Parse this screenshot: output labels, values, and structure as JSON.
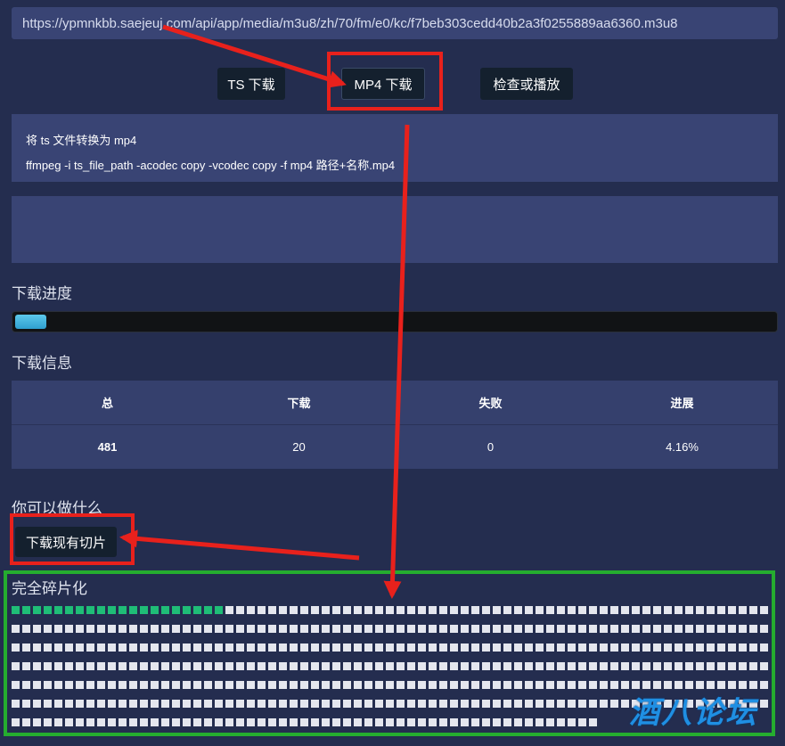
{
  "url": "https://ypmnkbb.saejeuj.com/api/app/media/m3u8/zh/70/fm/e0/kc/f7beb303cedd40b2a3f0255889aa6360.m3u8",
  "buttons": {
    "ts_download": "TS 下载",
    "mp4_download": "MP4 下载",
    "check_play": "检查或播放",
    "download_existing": "下载现有切片"
  },
  "info": {
    "line1": "将 ts 文件转换为 mp4",
    "line2": "ffmpeg -i ts_file_path -acodec copy -vcodec copy -f mp4 路径+名称.mp4"
  },
  "progress": {
    "title": "下载进度",
    "percent": 4.16
  },
  "download_info": {
    "title": "下载信息",
    "headers": [
      "总",
      "下载",
      "失败",
      "进展"
    ],
    "values": [
      "481",
      "20",
      "0",
      "4.16%"
    ]
  },
  "actions": {
    "title": "你可以做什么"
  },
  "fragments": {
    "title": "完全碎片化",
    "total": 481,
    "done": 20
  },
  "watermark": "酒八论坛",
  "colors": {
    "background": "#242d4f",
    "panel": "#394474",
    "button": "#14202e",
    "progress": "#3fb4de",
    "fragment_done": "#1fbd77",
    "fragment_pending": "#e4e6ee",
    "annotation_red": "#e8211c",
    "annotation_green": "#25ad2f"
  }
}
